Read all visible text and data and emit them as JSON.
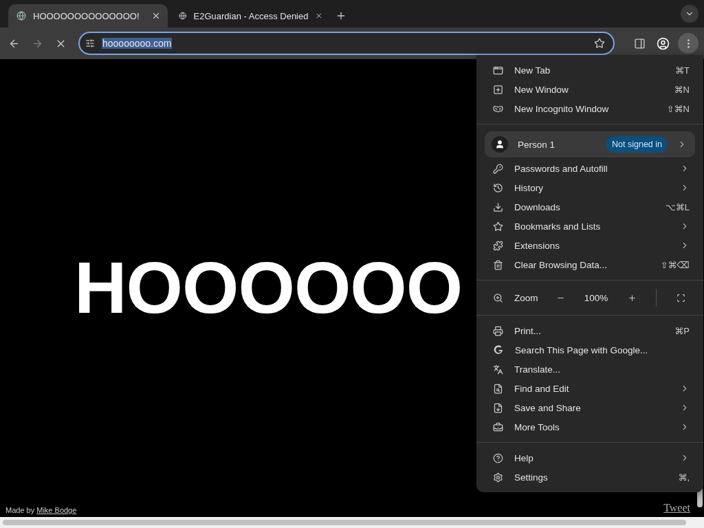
{
  "tabs": [
    {
      "title": "HOOOOOOOOOOOOOO!",
      "selected": true
    },
    {
      "title": "E2Guardian - Access Denied",
      "selected": false
    }
  ],
  "toolbar": {
    "loading": true,
    "address": {
      "value": "hoooooooo.com",
      "selected": true
    }
  },
  "page": {
    "heading": "HOOOOOO",
    "credit": "Made by",
    "credit_link": "Mike Bodge",
    "tweet": "Tweet"
  },
  "menu": {
    "sections": [
      [
        {
          "kind": "item",
          "label": "New Tab",
          "shortcut": "⌘T",
          "submenu": false
        },
        {
          "kind": "item",
          "label": "New Window",
          "shortcut": "⌘N",
          "submenu": false
        },
        {
          "kind": "item",
          "label": "New Incognito Window",
          "shortcut": "⇧⌘N",
          "submenu": false
        }
      ],
      [
        {
          "kind": "profile",
          "label": "Person 1",
          "badge": "Not signed in",
          "submenu": true
        },
        {
          "kind": "item",
          "label": "Passwords and Autofill",
          "submenu": true
        },
        {
          "kind": "item",
          "label": "History",
          "submenu": true
        },
        {
          "kind": "item",
          "label": "Downloads",
          "shortcut": "⌥⌘L",
          "submenu": false
        },
        {
          "kind": "item",
          "label": "Bookmarks and Lists",
          "submenu": true
        },
        {
          "kind": "item",
          "label": "Extensions",
          "submenu": true
        },
        {
          "kind": "item",
          "label": "Clear Browsing Data...",
          "shortcut": "⇧⌘⌫",
          "submenu": false
        }
      ],
      [
        {
          "kind": "zoom",
          "label": "Zoom",
          "value": "100%"
        }
      ],
      [
        {
          "kind": "item",
          "label": "Print...",
          "shortcut": "⌘P",
          "submenu": false
        },
        {
          "kind": "item",
          "label": "Search This Page with Google...",
          "submenu": false
        },
        {
          "kind": "item",
          "label": "Translate...",
          "submenu": false
        },
        {
          "kind": "item",
          "label": "Find and Edit",
          "submenu": true
        },
        {
          "kind": "item",
          "label": "Save and Share",
          "submenu": true
        },
        {
          "kind": "item",
          "label": "More Tools",
          "submenu": true
        }
      ],
      [
        {
          "kind": "item",
          "label": "Help",
          "submenu": true
        },
        {
          "kind": "item",
          "label": "Settings",
          "shortcut": "⌘,",
          "submenu": false
        }
      ]
    ]
  }
}
